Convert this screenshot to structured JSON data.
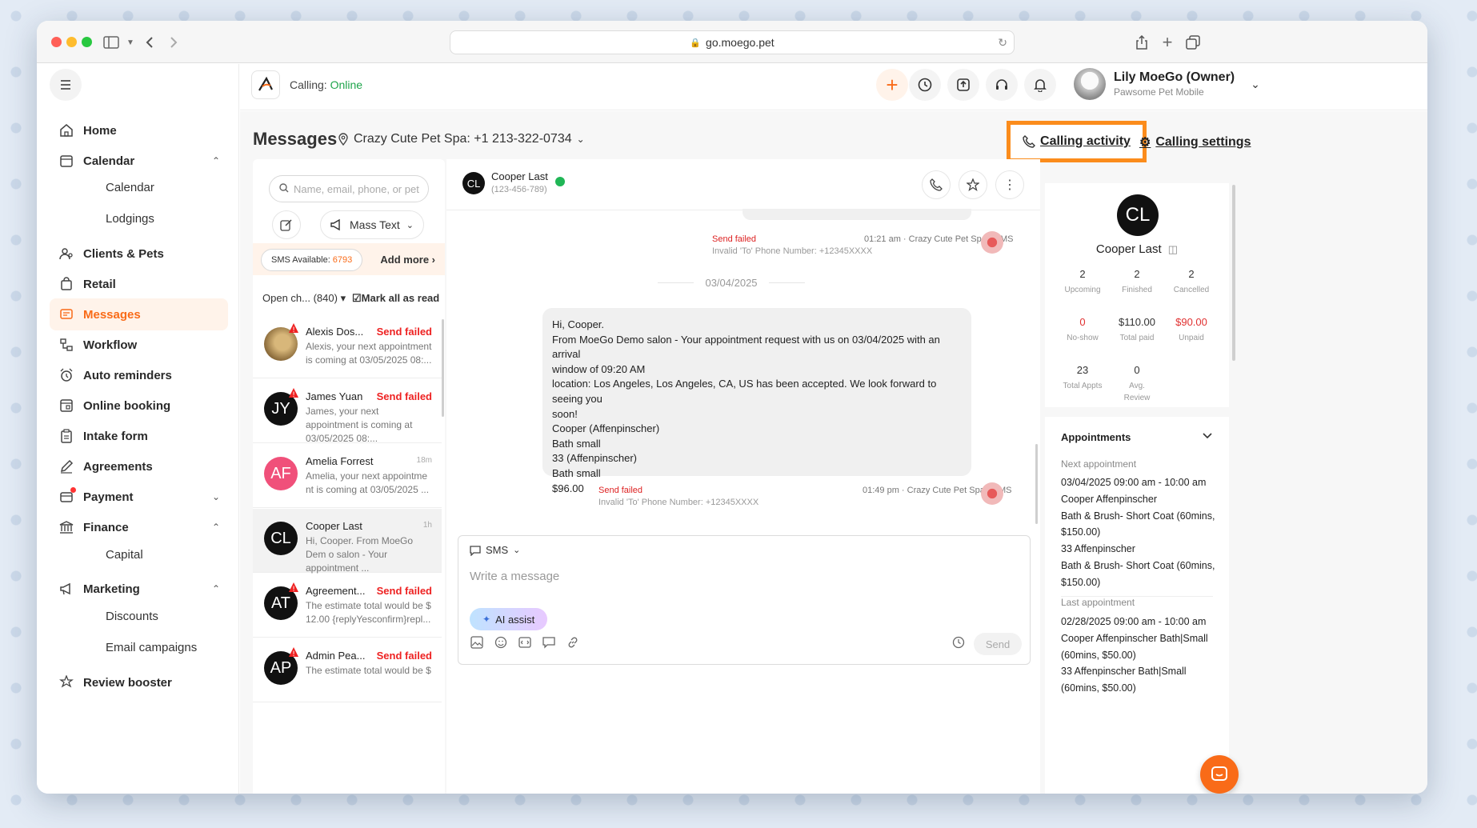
{
  "browser": {
    "url": "go.moego.pet"
  },
  "topbar": {
    "calling_label": "Calling:",
    "calling_status": "Online",
    "user_name": "Lily MoeGo (Owner)",
    "user_org": "Pawsome Pet Mobile"
  },
  "sidebar": {
    "items": [
      {
        "label": "Home"
      },
      {
        "label": "Calendar"
      },
      {
        "label": "Calendar"
      },
      {
        "label": "Lodgings"
      },
      {
        "label": "Clients & Pets"
      },
      {
        "label": "Retail"
      },
      {
        "label": "Messages"
      },
      {
        "label": "Workflow"
      },
      {
        "label": "Auto reminders"
      },
      {
        "label": "Online booking"
      },
      {
        "label": "Intake form"
      },
      {
        "label": "Agreements"
      },
      {
        "label": "Payment"
      },
      {
        "label": "Finance"
      },
      {
        "label": "Capital"
      },
      {
        "label": "Marketing"
      },
      {
        "label": "Discounts"
      },
      {
        "label": "Email campaigns"
      },
      {
        "label": "Review booster"
      }
    ]
  },
  "header": {
    "title": "Messages",
    "location": "Crazy Cute Pet Spa: +1 213-322-0734",
    "calling_activity": "Calling activity",
    "calling_settings": "Calling settings"
  },
  "list": {
    "search_placeholder": "Name, email, phone, or pet",
    "mass_text": "Mass Text",
    "sms_available_label": "SMS Available:",
    "sms_available_count": "6793",
    "add_more": "Add more",
    "filter": "Open ch... (840)",
    "mark_all": "Mark all as read",
    "conversations": [
      {
        "initials": "",
        "name": "Alexis Dos...",
        "status": "Send failed",
        "time": "",
        "preview": "Alexis, your next appointment is coming at 03/05/2025 08:...",
        "color": "#b08a50"
      },
      {
        "initials": "JY",
        "name": "James Yuan",
        "status": "Send failed",
        "time": "",
        "preview": "James, your next appointment is coming at 03/05/2025 08:...",
        "color": "#111111"
      },
      {
        "initials": "AF",
        "name": "Amelia Forrest",
        "status": "",
        "time": "18m",
        "preview": "Amelia, your next appointme nt is coming at 03/05/2025 ...",
        "color": "#f0507a"
      },
      {
        "initials": "CL",
        "name": "Cooper Last",
        "status": "",
        "time": "1h",
        "preview": "Hi, Cooper. From MoeGo Dem o salon - Your appointment ...",
        "color": "#111111"
      },
      {
        "initials": "AT",
        "name": "Agreement...",
        "status": "Send failed",
        "time": "",
        "preview": "The estimate total would be $ 12.00 {replyYesconfirm}repl...",
        "color": "#111111"
      },
      {
        "initials": "AP",
        "name": "Admin Pea...",
        "status": "Send failed",
        "time": "",
        "preview": "The estimate total would be $",
        "color": "#111111"
      }
    ]
  },
  "chat": {
    "contact_initials": "CL",
    "contact_name": "Cooper Last",
    "contact_phone": "(123-456-789)",
    "msg1": {
      "status": "Send failed",
      "error": "Invalid 'To' Phone Number: +12345XXXX",
      "meta": "01:21 am · Crazy Cute Pet Spa · SMS"
    },
    "date_sep": "03/04/2025",
    "msg2": {
      "lines": [
        "Hi, Cooper.",
        "From MoeGo Demo salon - Your appointment request with us on 03/04/2025 with an arrival",
        "window of 09:20 AM",
        "location: Los Angeles, Los Angeles, CA, US has been accepted. We look forward to seeing you",
        "soon!",
        "Cooper (Affenpinscher)",
        "Bath small",
        "33 (Affenpinscher)",
        "Bath small",
        "$96.00"
      ],
      "status": "Send failed",
      "error": "Invalid 'To' Phone Number: +12345XXXX",
      "meta": "01:49 pm · Crazy Cute Pet Spa · SMS"
    },
    "composer": {
      "channel": "SMS",
      "placeholder": "Write a message",
      "ai_assist": "AI assist",
      "send": "Send"
    }
  },
  "client": {
    "initials": "CL",
    "name": "Cooper Last",
    "stats": [
      {
        "value": "2",
        "label": "Upcoming",
        "color": "#333333"
      },
      {
        "value": "2",
        "label": "Finished",
        "color": "#333333"
      },
      {
        "value": "2",
        "label": "Cancelled",
        "color": "#333333"
      },
      {
        "value": "0",
        "label": "No-show",
        "color": "#e03030"
      },
      {
        "value": "$110.00",
        "label": "Total paid",
        "color": "#333333"
      },
      {
        "value": "$90.00",
        "label": "Unpaid",
        "color": "#e03030"
      },
      {
        "value": "23",
        "label": "Total Appts",
        "color": "#333333"
      },
      {
        "value": "0",
        "label": "Avg. Review",
        "color": "#333333"
      }
    ],
    "appointments_title": "Appointments",
    "next_label": "Next appointment",
    "next_lines": [
      "03/04/2025 09:00 am - 10:00 am",
      "Cooper Affenpinscher",
      "Bath & Brush- Short Coat (60mins,",
      "$150.00)",
      "33 Affenpinscher",
      "Bath & Brush- Short Coat (60mins,",
      "$150.00)"
    ],
    "last_label": "Last appointment",
    "last_lines": [
      "02/28/2025 09:00 am - 10:00 am",
      "Cooper Affenpinscher Bath|Small",
      "(60mins, $50.00)",
      "33 Affenpinscher Bath|Small",
      "(60mins, $50.00)"
    ]
  }
}
